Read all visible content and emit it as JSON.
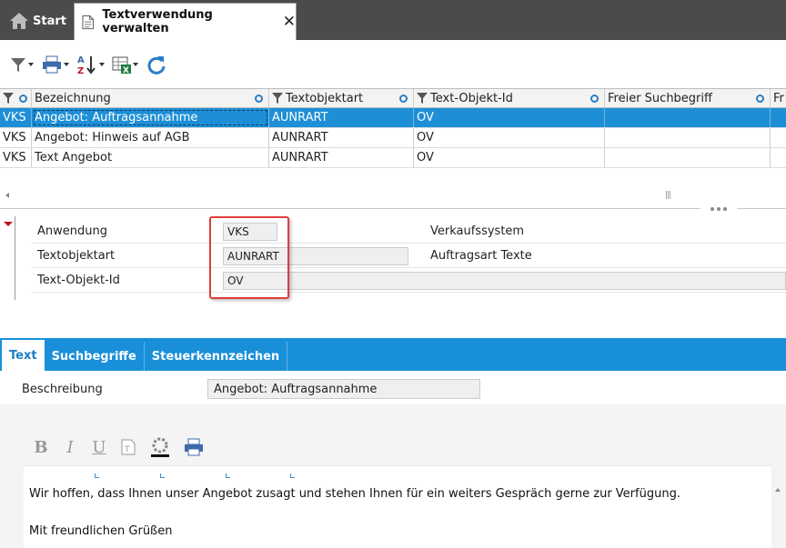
{
  "tabs": {
    "home_label": "Start",
    "active_label": "Textverwendung verwalten",
    "close_symbol": "✕"
  },
  "toolbar": {
    "icons": [
      "filter-icon",
      "print-icon",
      "sort-az-icon",
      "excel-export-icon",
      "refresh-icon"
    ],
    "accent": "#1e8fd6"
  },
  "grid": {
    "columns": [
      "",
      "Bezeichnung",
      "Textobjektart",
      "Text-Objekt-Id",
      "Freier Suchbegriff",
      "Fr"
    ],
    "rows": [
      {
        "app": "VKS",
        "bezeichnung": "Angebot: Auftragsannahme",
        "textobjektart": "AUNRART",
        "id": "OV",
        "frei": ""
      },
      {
        "app": "VKS",
        "bezeichnung": "Angebot: Hinweis auf AGB",
        "textobjektart": "AUNRART",
        "id": "OV",
        "frei": ""
      },
      {
        "app": "VKS",
        "bezeichnung": "Text Angebot",
        "textobjektart": "AUNRART",
        "id": "OV",
        "frei": ""
      }
    ],
    "selected_row": 0,
    "selected_color": "#1e8fd6"
  },
  "detail": {
    "anwendung_label": "Anwendung",
    "anwendung_value": "VKS",
    "anwendung_desc": "Verkaufssystem",
    "textobjektart_label": "Textobjektart",
    "textobjektart_value": "AUNRART",
    "textobjektart_desc": "Auftragsart Texte",
    "textobjektid_label": "Text-Objekt-Id",
    "textobjektid_value": "OV",
    "highlight_color": "#e03c3c"
  },
  "bottom_tabs": {
    "items": [
      "Text",
      "Suchbegriffe",
      "Steuerkennzeichen"
    ],
    "active": 0,
    "color": "#1a8fd9"
  },
  "text_tab": {
    "beschreibung_label": "Beschreibung",
    "beschreibung_value": "Angebot: Auftragsannahme",
    "editor_line1": "Wir hoffen, dass Ihnen unser Angebot zusagt und stehen Ihnen für ein weiters Gespräch gerne zur Verfügung.",
    "editor_line2": "Mit freundlichen Grüßen",
    "editor_tools": {
      "bold": "B",
      "italic": "I",
      "underline": "U"
    }
  }
}
